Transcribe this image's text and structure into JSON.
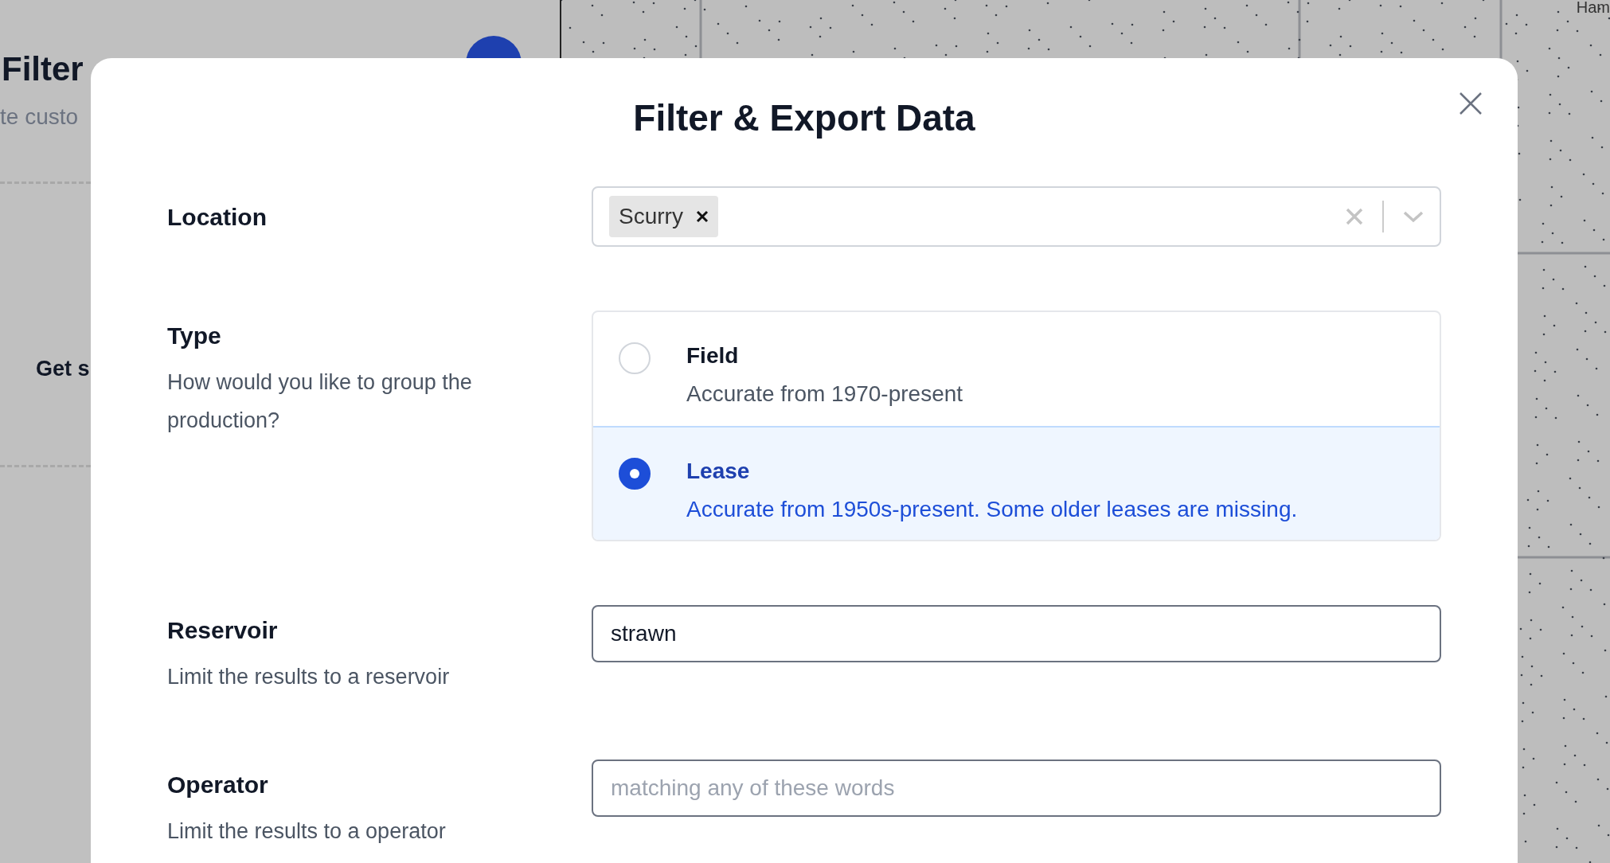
{
  "background": {
    "heading": "Filter",
    "subtitle": "te custo",
    "section_label": "Get s"
  },
  "map": {
    "label": "Ham"
  },
  "dialog": {
    "title": "Filter & Export Data",
    "fields": [
      {
        "kind": "multiselect",
        "label": "Location",
        "tags": [
          "Scurry"
        ]
      },
      {
        "kind": "radio",
        "label": "Type",
        "description": "How would you like to group the production?",
        "options": [
          {
            "title": "Field",
            "description": "Accurate from 1970-present",
            "selected": false
          },
          {
            "title": "Lease",
            "description": "Accurate from 1950s-present. Some older leases are missing.",
            "selected": true
          }
        ]
      },
      {
        "kind": "text",
        "label": "Reservoir",
        "description": "Limit the results to a reservoir",
        "value": "strawn"
      },
      {
        "kind": "text",
        "label": "Operator",
        "description": "Limit the results to a operator",
        "placeholder": "matching any of these words"
      }
    ]
  }
}
